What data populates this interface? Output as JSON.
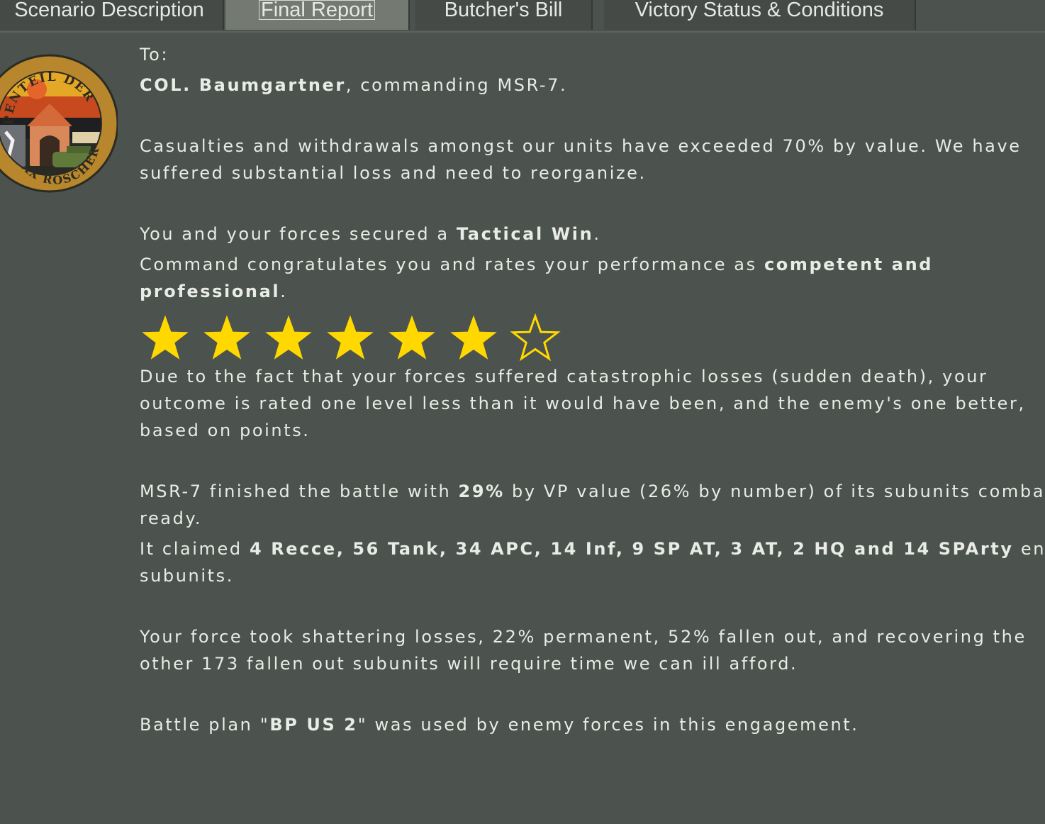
{
  "tabs": [
    {
      "label": "Scenario Description",
      "active": false
    },
    {
      "label": "Final Report",
      "active": true
    },
    {
      "label": "Butcher's Bill",
      "active": false
    },
    {
      "label": "Victory Status & Conditions",
      "active": false
    }
  ],
  "emblem": {
    "text_top": "PENTEIL DER NVA",
    "text_bottom": "AX ROSCHER"
  },
  "report": {
    "to_label": "To:",
    "recipient_name": "COL. Baumgartner",
    "recipient_rest": ", commanding MSR-7.",
    "casualties_line1": "Casualties and withdrawals amongst our units have exceeded 70% by value. We have",
    "casualties_line2": "suffered substantial loss and need to reorganize.",
    "secured_pre": "You and your forces secured a ",
    "secured_result": "Tactical Win",
    "secured_post": ".",
    "congrats_pre": "Command congratulates you and rates your performance as ",
    "congrats_rating_1": "competent and",
    "congrats_rating_2": "professional",
    "congrats_post": ".",
    "rating": {
      "filled": 6,
      "total": 7,
      "star_color": "#ffd800"
    },
    "sudden_line1": "Due to the fact that your forces suffered catastrophic losses (sudden death), your",
    "sudden_line2": "outcome is rated one level less than it would have been, and the enemy's one better,",
    "sudden_line3": "based on points.",
    "finished_pre": "MSR-7 finished the battle with ",
    "finished_pct": "29%",
    "finished_post": " by VP value (26% by number) of its subunits comba",
    "finished_line2": "ready.",
    "claimed_pre": "It claimed ",
    "claimed_list": "4 Recce, 56 Tank, 34 APC, 14 Inf, 9 SP AT, 3 AT, 2 HQ and 14 SPArty",
    "claimed_post": " enemy",
    "claimed_line2": "subunits.",
    "losses_line1": "Your force took shattering losses, 22% permanent, 52% fallen out, and recovering the",
    "losses_line2": "other 173 fallen out subunits will require time we can ill afford.",
    "plan_pre": "Battle plan \"",
    "plan_name": "BP US 2",
    "plan_post": "\" was used by enemy forces in this engagement."
  }
}
